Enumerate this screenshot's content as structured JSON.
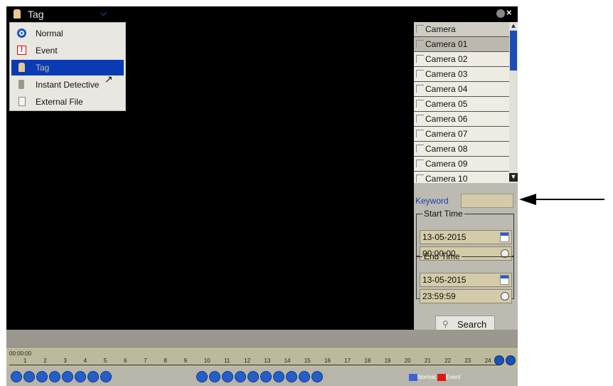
{
  "title_bar": {
    "mode": "Tag"
  },
  "menu": {
    "items": [
      {
        "label": "Normal"
      },
      {
        "label": "Event"
      },
      {
        "label": "Tag"
      },
      {
        "label": "Instant Detective"
      },
      {
        "label": "External File"
      }
    ],
    "selected": "Tag"
  },
  "camera_list": {
    "header": "Camera",
    "cameras": [
      "Camera 01",
      "Camera 02",
      "Camera 03",
      "Camera 04",
      "Camera 05",
      "Camera 06",
      "Camera 07",
      "Camera 08",
      "Camera 09",
      "Camera 10"
    ],
    "selected": "Camera 01"
  },
  "keyword": {
    "label": "Keyword",
    "value": ""
  },
  "start_time": {
    "legend": "Start Time",
    "date": "13-05-2015",
    "time": "00:00:00"
  },
  "end_time": {
    "legend": "End Time",
    "date": "13-05-2015",
    "time": "23:59:59"
  },
  "search_button": {
    "label": "Search"
  },
  "timeline": {
    "start_label": "00:00:00",
    "ticks": [
      "1",
      "2",
      "3",
      "4",
      "5",
      "6",
      "7",
      "8",
      "9",
      "10",
      "11",
      "12",
      "13",
      "14",
      "15",
      "16",
      "17",
      "18",
      "19",
      "20",
      "21",
      "22",
      "23",
      "24"
    ]
  },
  "legend": {
    "normal": "Normal",
    "event": "Event"
  },
  "colors": {
    "normal": "#3d62d6",
    "event": "#e01818",
    "accent": "#0a3bb4"
  }
}
